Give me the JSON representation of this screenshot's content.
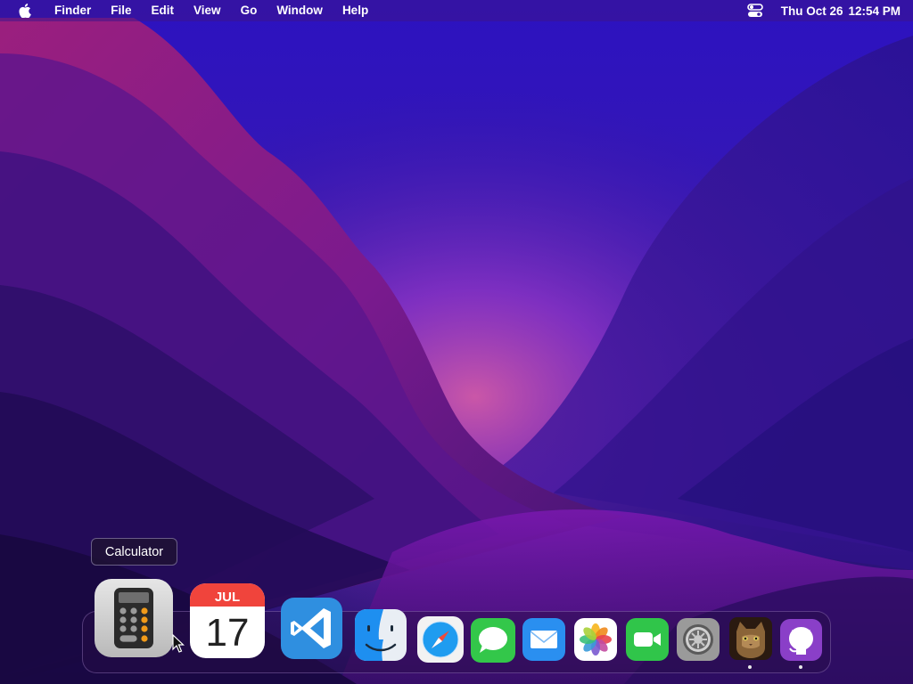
{
  "menubar": {
    "app_name": "Finder",
    "menus": [
      "File",
      "Edit",
      "View",
      "Go",
      "Window",
      "Help"
    ],
    "clock_day": "Thu Oct 26",
    "clock_time": "12:54 PM"
  },
  "tooltip": {
    "text": "Calculator"
  },
  "dock": {
    "calendar_month": "JUL",
    "calendar_day": "17",
    "items": [
      {
        "name": "Calculator",
        "icon": "calculator-icon",
        "running": false
      },
      {
        "name": "Calendar",
        "icon": "calendar-icon",
        "running": false
      },
      {
        "name": "Visual Studio Code",
        "icon": "vscode-icon",
        "running": false
      },
      {
        "name": "Finder",
        "icon": "finder-icon",
        "running": false
      },
      {
        "name": "Safari",
        "icon": "safari-icon",
        "running": false
      },
      {
        "name": "Messages",
        "icon": "messages-icon",
        "running": false
      },
      {
        "name": "Mail",
        "icon": "mail-icon",
        "running": false
      },
      {
        "name": "Photos",
        "icon": "photos-icon",
        "running": false
      },
      {
        "name": "FaceTime",
        "icon": "facetime-icon",
        "running": false
      },
      {
        "name": "System Settings",
        "icon": "settings-icon",
        "running": false
      },
      {
        "name": "Cat",
        "icon": "cat-app-icon",
        "running": true
      },
      {
        "name": "GitHub Desktop",
        "icon": "github-icon",
        "running": true
      }
    ]
  },
  "colors": {
    "wallpaper_top": "#2d13b8",
    "wallpaper_accent": "#c2307e",
    "wallpaper_bottom": "#1c0c4e"
  }
}
